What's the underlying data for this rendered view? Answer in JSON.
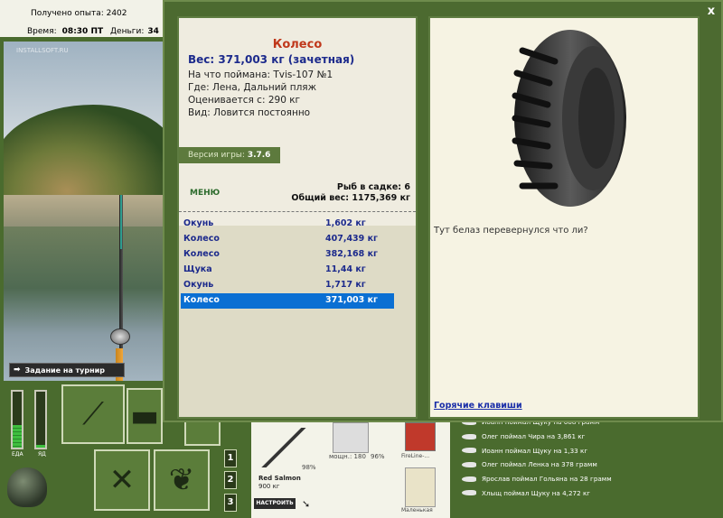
{
  "header": {
    "experience": "Получено опыта: 2402",
    "time_label": "Время:",
    "time_value": "08:30 ПТ",
    "money_label": "Деньги:",
    "money_value": "34"
  },
  "scene": {
    "watermark": "INSTALLSOFT.RU",
    "task_button": "Задание на турнир"
  },
  "status": {
    "food_label": "ЕДА",
    "poison_label": "ЯД",
    "food_level": 0.4,
    "poison_level": 0.05
  },
  "slots": [
    "1",
    "2",
    "3"
  ],
  "tackle": {
    "fish_name": "Red Salmon",
    "fish_weight": "900 кг",
    "rod_percent": "98%",
    "power_label": "мощн.: 180",
    "reel_percent": "96%",
    "line_label": "FireLine-...",
    "lure_label": "Маленькая",
    "setup_button": "НАСТРОИТЬ"
  },
  "news": [
    "Иоанн поймал Щуку на 668 грамм",
    "Олег поймал Чира на 3,861 кг",
    "Иоанн поймал Щуку на 1,33 кг",
    "Олег поймал Ленка на 378 грамм",
    "Ярослав поймал Гольяна на 28 грамм",
    "Хлыщ поймал Щуку на 4,272 кг"
  ],
  "dialog": {
    "close": "x",
    "fish_title": "Колесо",
    "weight_line": "Вес: 371,003 кг (зачетная)",
    "caught_on": "На что поймана: Tvis-107 №1",
    "location": "Где: Лена, Дальний пляж",
    "price": "Оценивается с: 290 кг",
    "kind": "Вид: Ловится постоянно",
    "version_label": "Версия игры:",
    "version_value": "3.7.6",
    "menu": "МЕНЮ",
    "keepnet_count": "Рыб в садке: 6",
    "keepnet_total": "Общий вес: 1175,369 кг",
    "comment": "Тут белаз перевернулся что ли?",
    "hotkeys": "Горячие клавиши"
  },
  "catch": [
    {
      "name": "Окунь",
      "weight": "1,602 кг"
    },
    {
      "name": "Колесо",
      "weight": "407,439 кг"
    },
    {
      "name": "Колесо",
      "weight": "382,168 кг"
    },
    {
      "name": "Щука",
      "weight": "11,44 кг"
    },
    {
      "name": "Окунь",
      "weight": "1,717 кг"
    },
    {
      "name": "Колесо",
      "weight": "371,003 кг"
    }
  ],
  "selected_catch_index": 5,
  "colors": {
    "accent_title": "#c0381b",
    "weight_blue": "#1c2a8c",
    "selection": "#0a6fd3",
    "frame_green": "#4c6a30"
  },
  "icons": [
    "rod-icon",
    "box-icon",
    "cutlery-icon",
    "fish-icon",
    "pot-icon",
    "arrow-right-icon",
    "pointer-icon",
    "close-icon"
  ]
}
